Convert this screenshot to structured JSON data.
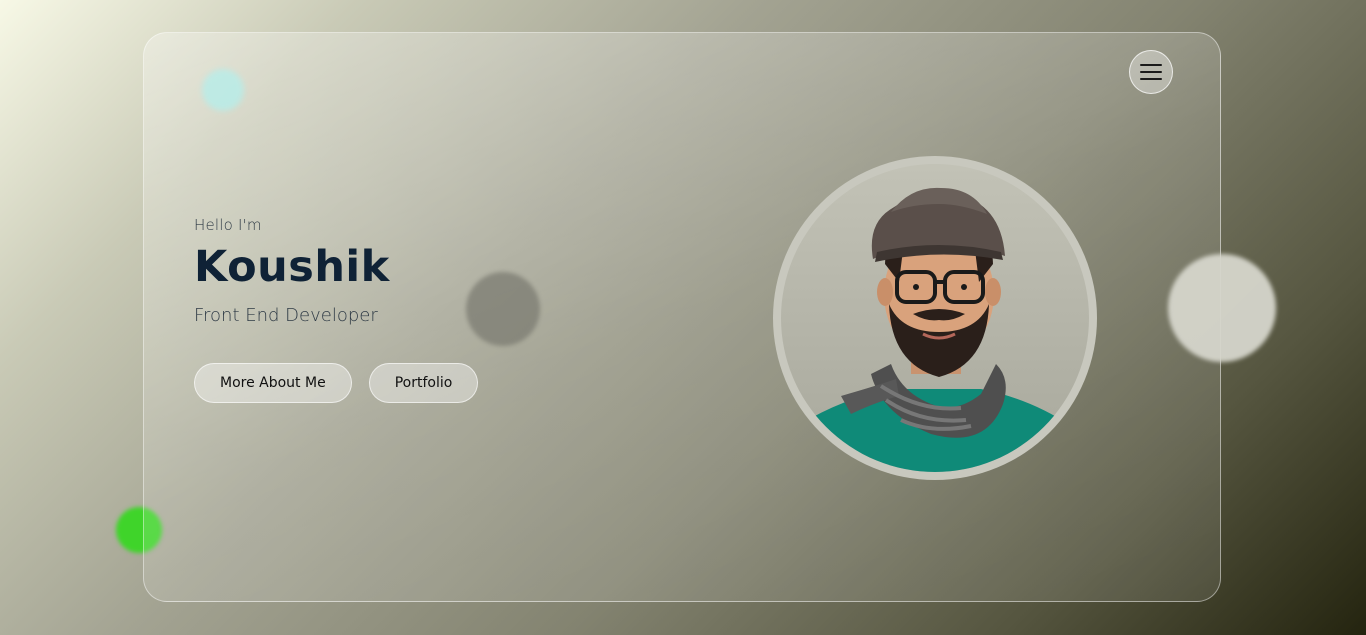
{
  "hero": {
    "greeting": "Hello I'm",
    "name": "Koushik",
    "role": "Front End Developer"
  },
  "buttons": {
    "more_about": "More About Me",
    "portfolio": "Portfolio"
  },
  "icons": {
    "menu": "hamburger-menu-icon"
  },
  "colors": {
    "name_text": "#0f2236",
    "accent_green": "#3fd42a",
    "accent_cyan": "#9fe6e0"
  }
}
